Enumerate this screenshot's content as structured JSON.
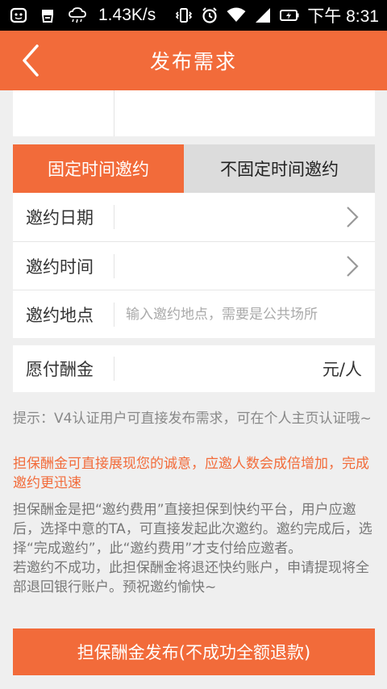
{
  "status_bar": {
    "speed": "1.43K/s",
    "time": "下午 8:31"
  },
  "header": {
    "title": "发布需求"
  },
  "tabs": [
    {
      "label": "固定时间邀约",
      "active": true
    },
    {
      "label": "不固定时间邀约",
      "active": false
    }
  ],
  "form": {
    "date_label": "邀约日期",
    "time_label": "邀约时间",
    "location_label": "邀约地点",
    "location_placeholder": "输入邀约地点，需要是公共场所",
    "reward_label": "愿付酬金",
    "reward_unit": "元/人"
  },
  "notes": {
    "tip": "提示：V4认证用户可直接发布需求，可在个人主页认证哦~",
    "highlight": "担保酬金可直接展现您的诚意，应邀人数会成倍增加，完成邀约更迅速",
    "desc_1": "担保酬金是把“邀约费用”直接担保到快约平台，用户应邀后，选择中意的TA，可直接发起此次邀约。邀约完成后，选择“完成邀约”，此“邀约费用”才支付给应邀者。",
    "desc_2": "若邀约不成功，此担保酬金将退还快约账户，申请提现将全部退回银行账户。预祝邀约愉快~"
  },
  "submit_label": "担保酬金发布(不成功全额退款)",
  "colors": {
    "accent": "#f26b3a",
    "background": "#efefef",
    "tab_inactive": "#dcdcdc"
  }
}
